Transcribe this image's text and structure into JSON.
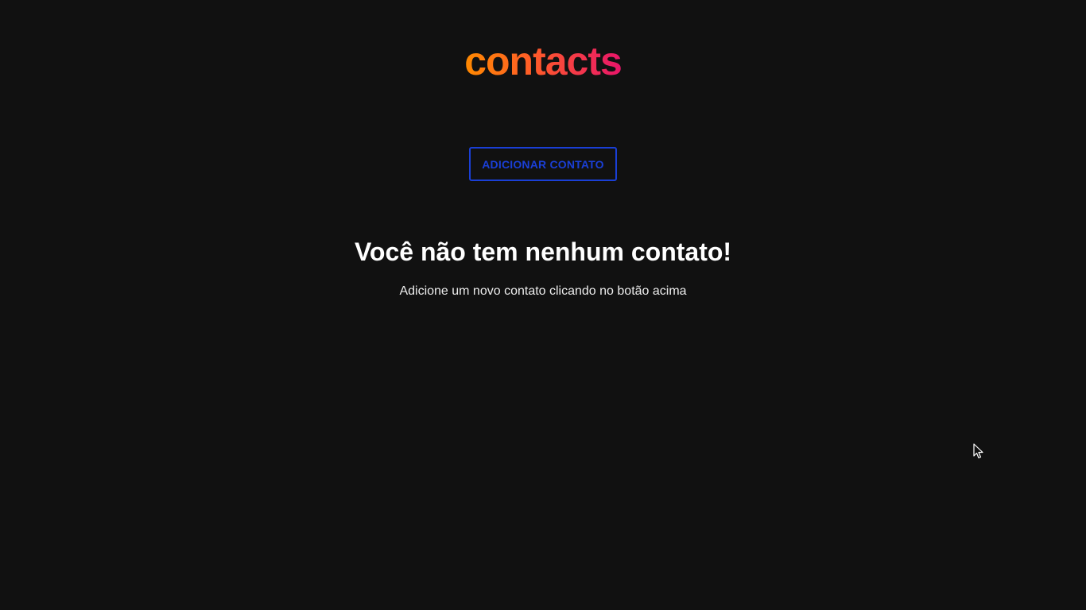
{
  "header": {
    "logo_text": "contacts",
    "logo_gradient": [
      "#ff8a00",
      "#e8156a"
    ]
  },
  "actions": {
    "add_contact_label": "ADICIONAR CONTATO",
    "accent_color": "#1a3fd6"
  },
  "empty_state": {
    "title": "Você não tem nenhum contato!",
    "subtitle": "Adicione um novo contato clicando no botão acima"
  },
  "theme": {
    "background": "#111111",
    "text": "#ffffff"
  },
  "cursor": {
    "icon": "arrow-cursor-icon"
  }
}
